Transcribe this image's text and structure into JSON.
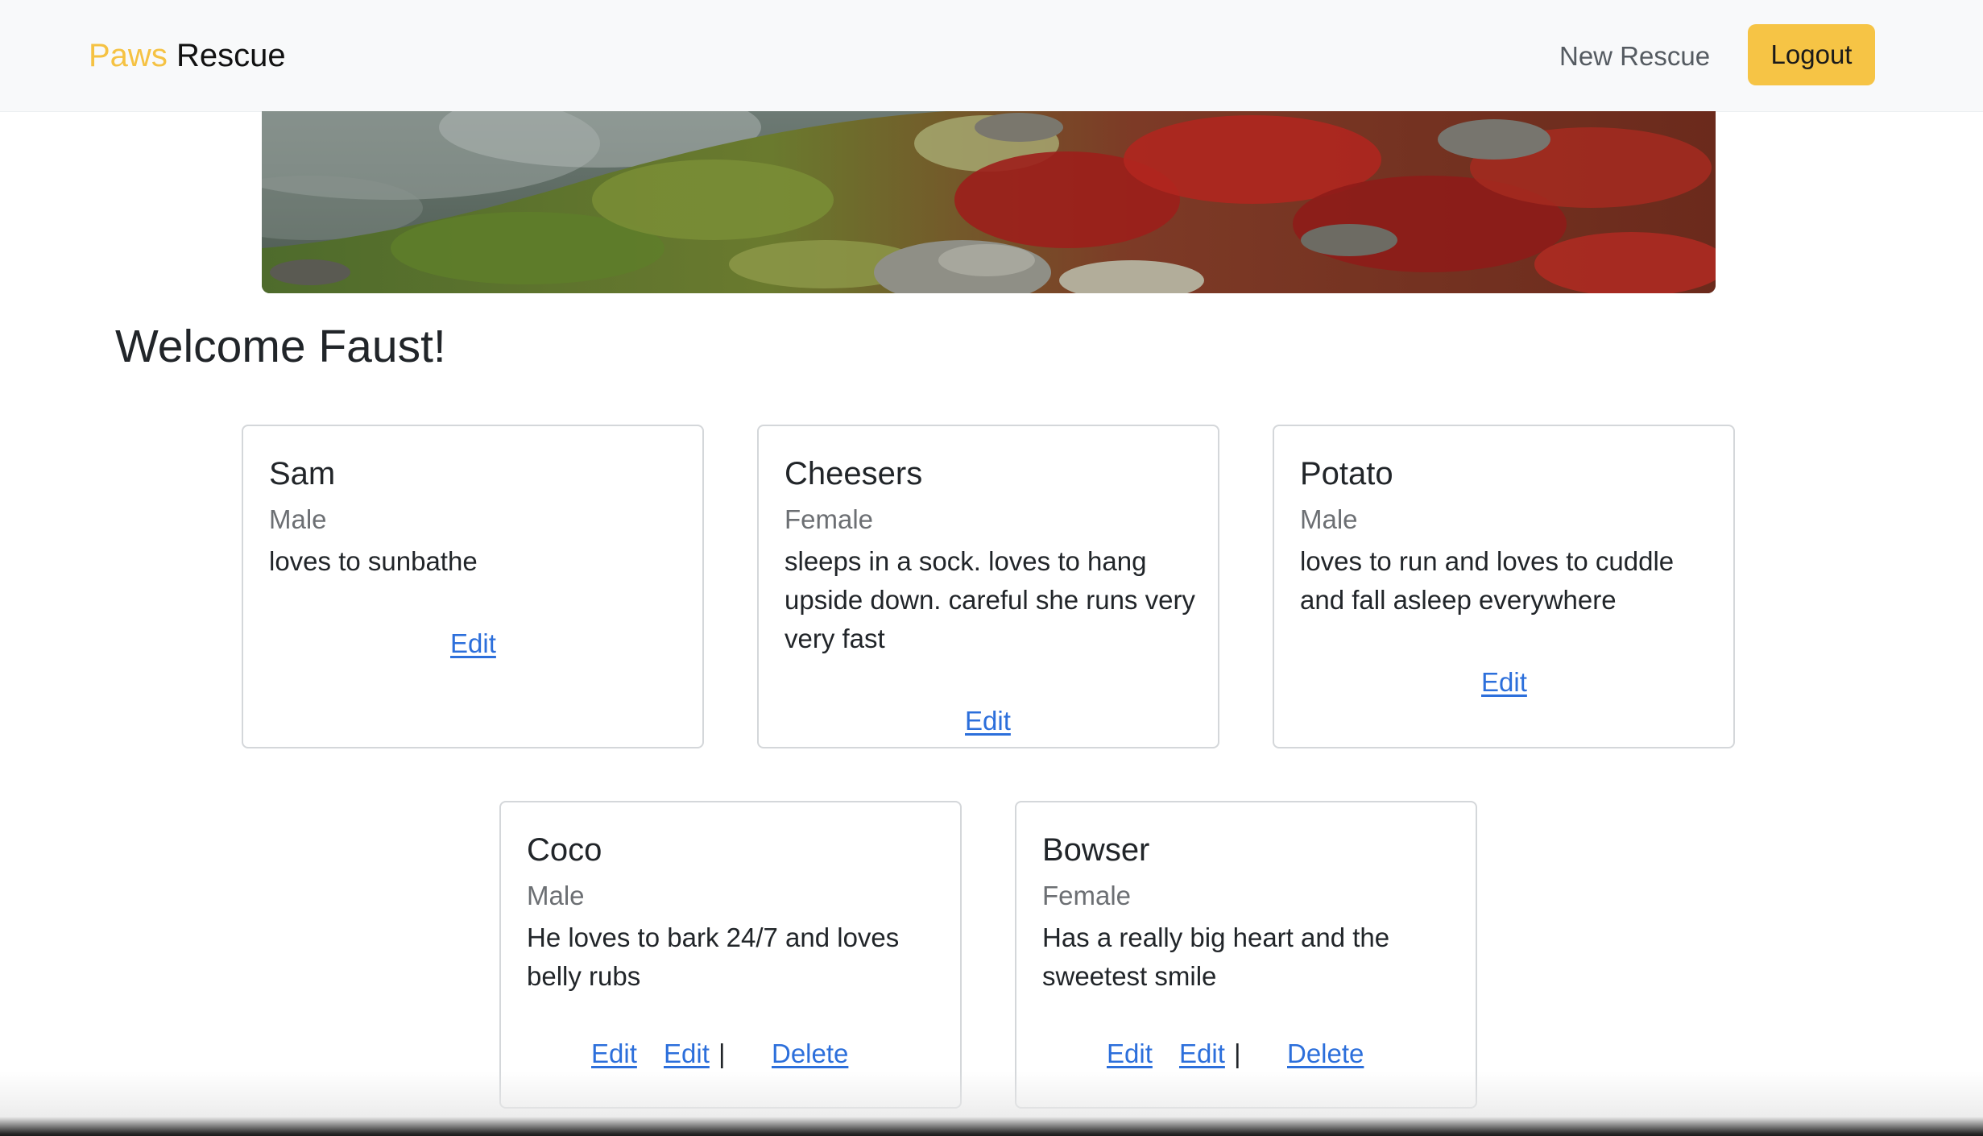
{
  "navbar": {
    "brand_accent": "Paws",
    "brand_main": "Rescue",
    "new_rescue_label": "New Rescue",
    "logout_label": "Logout"
  },
  "hero": {
    "image_label": "mountain-meadow-image"
  },
  "welcome": "Welcome Faust!",
  "cards": [
    {
      "name": "Sam",
      "gender": "Male",
      "description": "loves to sunbathe",
      "edit_label": "Edit"
    },
    {
      "name": "Cheesers",
      "gender": "Female",
      "description": "sleeps in a sock. loves to hang upside down. careful she runs very very fast",
      "edit_label": "Edit"
    },
    {
      "name": "Potato",
      "gender": "Male",
      "description": "loves to run and loves to cuddle and fall asleep everywhere",
      "edit_label": "Edit"
    },
    {
      "name": "Coco",
      "gender": "Male",
      "description": "He loves to bark 24/7 and loves belly rubs",
      "edit_label": "Edit",
      "edit2_label": "Edit",
      "separator": "|",
      "delete_label": "Delete"
    },
    {
      "name": "Bowser",
      "gender": "Female",
      "description": "Has a really big heart and the sweetest smile",
      "edit_label": "Edit",
      "edit2_label": "Edit",
      "separator": "|",
      "delete_label": "Delete"
    }
  ],
  "colors": {
    "brand_accent": "#f5c243",
    "logout_button": "#f6c445",
    "link": "#2c6fdb",
    "navbar_bg": "#f8f9fa"
  }
}
